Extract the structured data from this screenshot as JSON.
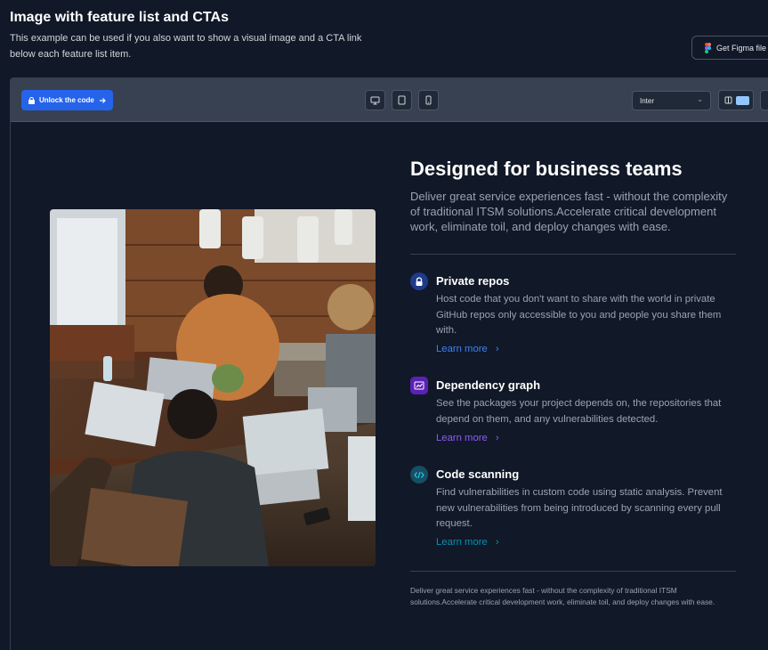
{
  "page": {
    "title": "Image with feature list and CTAs",
    "description": "This example can be used if you also want to show a visual image and a CTA link below each feature list item.",
    "figma_button": "Get Figma file"
  },
  "toolbar": {
    "unlock_label": "Unlock the code",
    "font_value": "Inter",
    "devices": [
      "desktop-icon",
      "tablet-icon",
      "mobile-icon"
    ]
  },
  "preview": {
    "heading": "Designed for business teams",
    "lead": "Deliver great service experiences fast - without the complexity of traditional ITSM solutions.Accelerate critical development work, eliminate toil, and deploy changes with ease.",
    "features": [
      {
        "icon": "lock-icon",
        "title": "Private repos",
        "description": "Host code that you don't want to share with the world in private GitHub repos only accessible to you and people you share them with.",
        "link": "Learn more",
        "accent": "#3b82f6",
        "icon_bg": "#1e3a8a"
      },
      {
        "icon": "graph-icon",
        "title": "Dependency graph",
        "description": "See the packages your project depends on, the repositories that depend on them, and any vulnerabilities detected.",
        "link": "Learn more",
        "accent": "#8b5cf6",
        "icon_bg": "#5b21b6"
      },
      {
        "icon": "code-icon",
        "title": "Code scanning",
        "description": "Find vulnerabilities in custom code using static analysis. Prevent new vulnerabilities from being introduced by scanning every pull request.",
        "link": "Learn more",
        "accent": "#0891b2",
        "icon_bg": "#164e63"
      }
    ],
    "footnote": "Deliver great service experiences fast - without the complexity of traditional ITSM solutions.Accelerate critical development work, eliminate toil, and deploy changes with ease."
  },
  "colors": {
    "background": "#111827",
    "toolbar": "#374151",
    "primary": "#2563eb"
  }
}
